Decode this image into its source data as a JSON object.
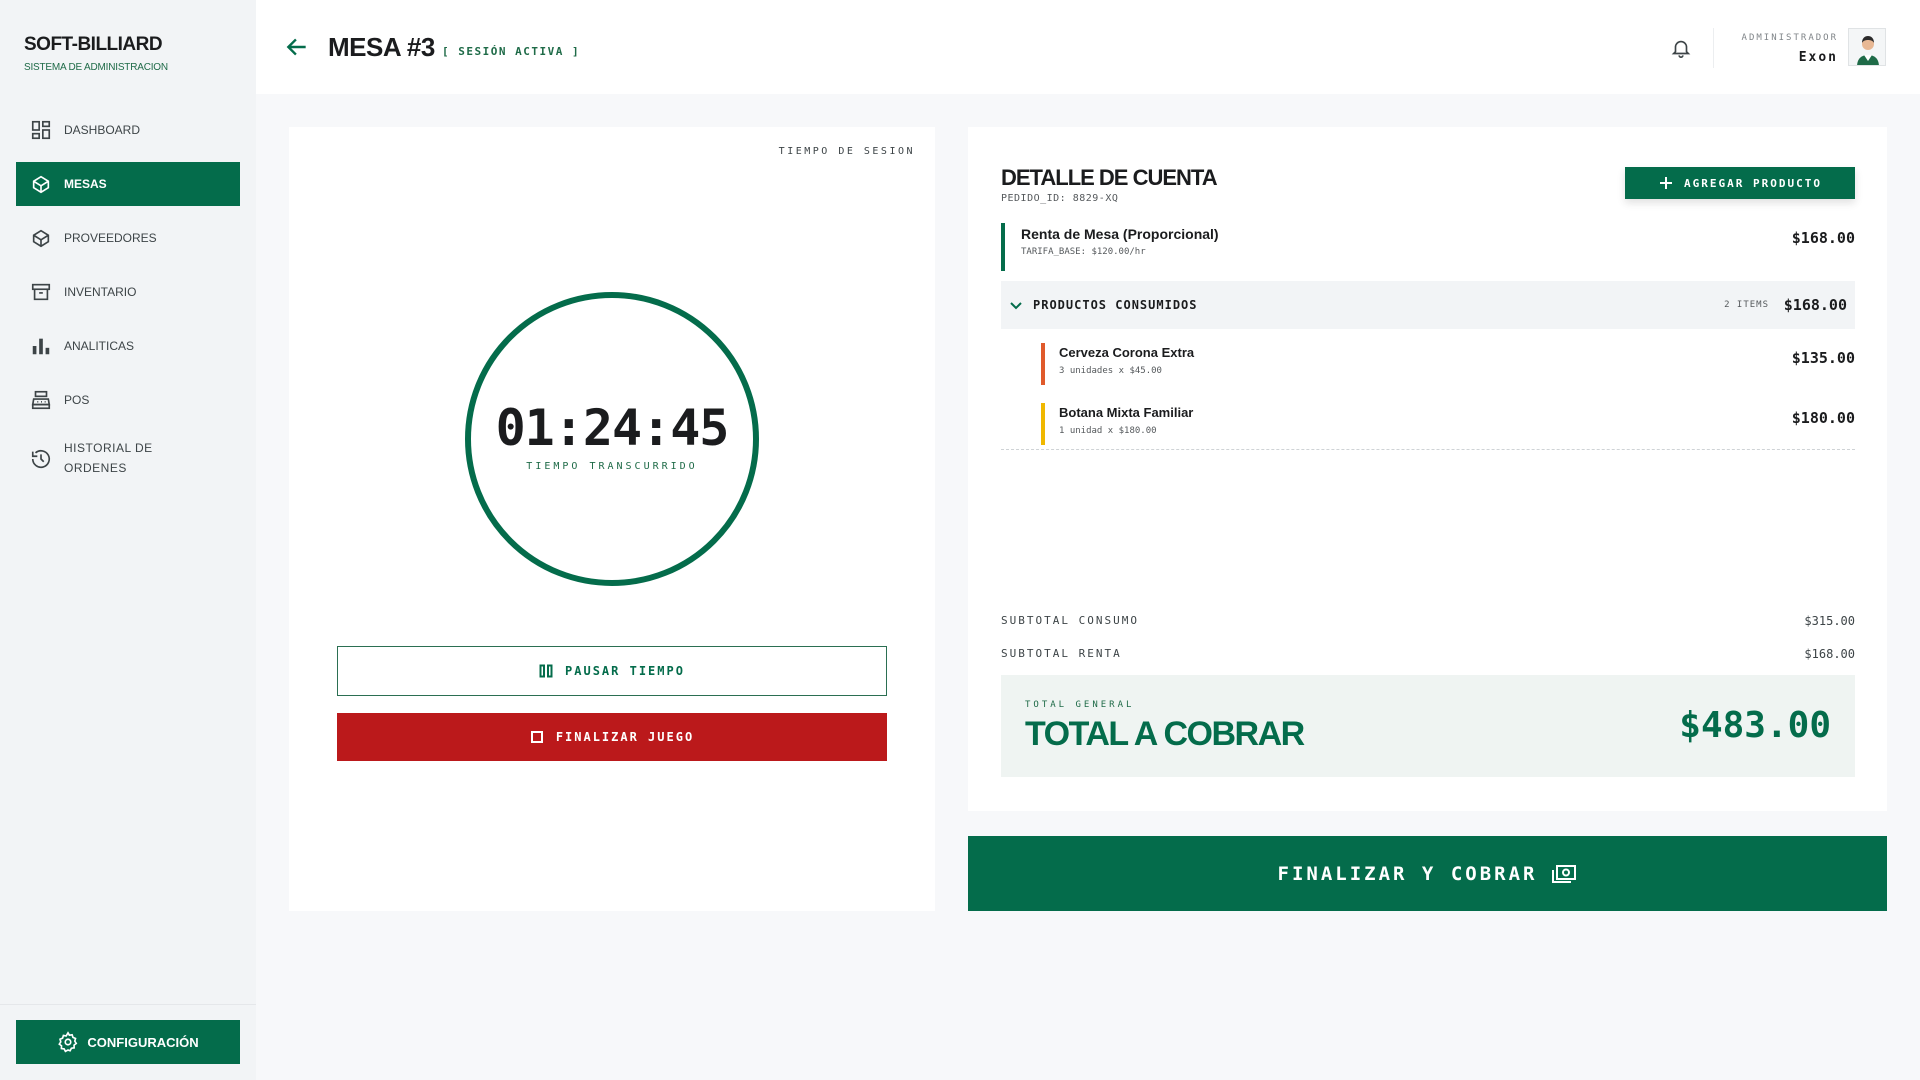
{
  "brand": {
    "name": "SOFT-BILLIARD",
    "subtitle": "SISTEMA DE ADMINISTRACION"
  },
  "nav": {
    "items": [
      {
        "label": "DASHBOARD",
        "icon": "dashboard-icon"
      },
      {
        "label": "MESAS",
        "icon": "billiard-icon",
        "active": true
      },
      {
        "label": "PROVEEDORES",
        "icon": "box-icon"
      },
      {
        "label": "INVENTARIO",
        "icon": "archive-icon"
      },
      {
        "label": "ANALITICAS",
        "icon": "bar-chart-icon"
      },
      {
        "label": "POS",
        "icon": "cash-register-icon"
      },
      {
        "label_line1": "HISTORIAL DE",
        "label_line2": "ORDENES",
        "icon": "history-icon"
      }
    ],
    "config_label": "CONFIGURACIÓN"
  },
  "header": {
    "title": "MESA #3",
    "session_badge": "[ SESIÓN ACTIVA ]",
    "user_role": "ADMINISTRADOR",
    "user_name": "Exon"
  },
  "timer": {
    "top_label": "TIEMPO DE SESION",
    "value": "01:24:45",
    "sub_label": "TIEMPO TRANSCURRIDO",
    "pause_label": "PAUSAR TIEMPO",
    "end_label": "FINALIZAR JUEGO"
  },
  "account": {
    "title": "DETALLE DE CUENTA",
    "order_id": "PEDIDO_ID: 8829-XQ",
    "add_product_label": "AGREGAR PRODUCTO",
    "rent": {
      "name": "Renta de Mesa (Proporcional)",
      "rate": "TARIFA_BASE: $120.00/hr",
      "price": "$168.00"
    },
    "products_header": {
      "title": "PRODUCTOS CONSUMIDOS",
      "count": "2 ITEMS",
      "total": "$168.00"
    },
    "products": [
      {
        "name": "Cerveza Corona Extra",
        "detail": "3 unidades x $45.00",
        "price": "$135.00",
        "color": "#e05a2b"
      },
      {
        "name": "Botana Mixta Familiar",
        "detail": "1 unidad x $180.00",
        "price": "$180.00",
        "color": "#f0b800"
      }
    ],
    "subtotal_consumo_label": "SUBTOTAL CONSUMO",
    "subtotal_consumo": "$315.00",
    "subtotal_renta_label": "SUBTOTAL RENTA",
    "subtotal_renta": "$168.00",
    "total_small": "TOTAL GENERAL",
    "total_big": "TOTAL A COBRAR",
    "total_amount": "$483.00"
  },
  "checkout_label": "FINALIZAR Y COBRAR",
  "colors": {
    "primary": "#046c4b",
    "danger": "#bb191b"
  }
}
